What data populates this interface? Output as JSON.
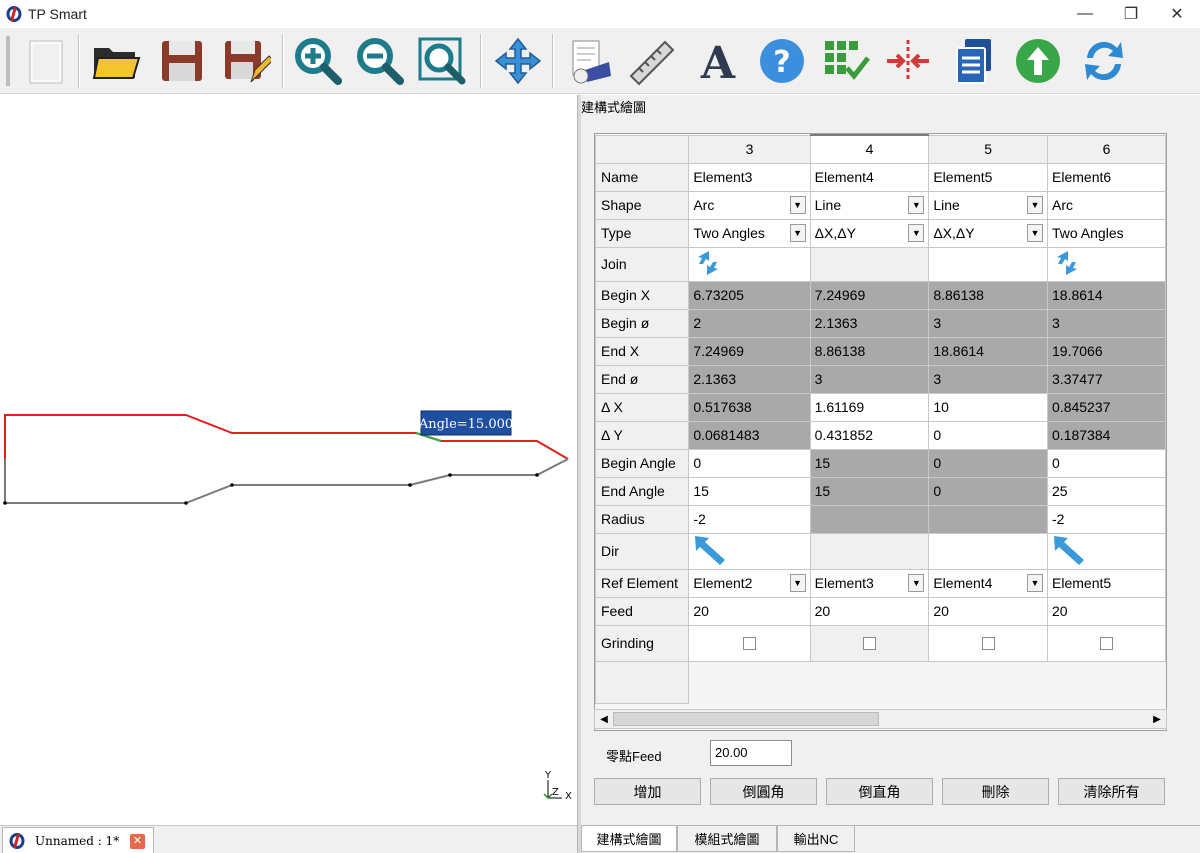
{
  "window": {
    "title": "TP Smart",
    "minimize": "—",
    "restore": "❐",
    "close": "✕"
  },
  "toolbar": {
    "buttons": [
      "new-icon",
      "open-folder-icon",
      "save-icon",
      "save-as-icon",
      "zoom-in-icon",
      "zoom-out-icon",
      "zoom-fit-icon",
      "pan-icon",
      "print-preview-icon",
      "ruler-icon",
      "text-icon",
      "help-icon",
      "grid-check-icon",
      "split-icon",
      "copy-icon",
      "upload-icon",
      "refresh-icon"
    ]
  },
  "canvas": {
    "tooltip": "Angle=15.000",
    "axis_y": "Y",
    "axis_z": "Z",
    "axis_x": "X"
  },
  "doc_tab": {
    "label": "Unnamed : 1*",
    "close": "✕"
  },
  "panel": {
    "title": "建構式繪圖"
  },
  "grid": {
    "columns": [
      "3",
      "4",
      "5",
      "6"
    ],
    "active_column": "4",
    "row_labels": {
      "name": "Name",
      "shape": "Shape",
      "type": "Type",
      "join": "Join",
      "begin_x": "Begin X",
      "begin_d": "Begin ø",
      "end_x": "End X",
      "end_d": "End ø",
      "dx": "Δ X",
      "dy": "Δ Y",
      "begin_angle": "Begin Angle",
      "end_angle": "End Angle",
      "radius": "Radius",
      "dir": "Dir",
      "ref": "Ref Element",
      "feed": "Feed",
      "grinding": "Grinding"
    },
    "cells": {
      "name": [
        "Element3",
        "Element4",
        "Element5",
        "Element6"
      ],
      "shape": [
        "Arc",
        "Line",
        "Line",
        "Arc"
      ],
      "type": [
        "Two Angles",
        "ΔX,ΔY",
        "ΔX,ΔY",
        "Two Angles"
      ],
      "begin_x": [
        "6.73205",
        "7.24969",
        "8.86138",
        "18.8614"
      ],
      "begin_d": [
        "2",
        "2.1363",
        "3",
        "3"
      ],
      "end_x": [
        "7.24969",
        "8.86138",
        "18.8614",
        "19.7066"
      ],
      "end_d": [
        "2.1363",
        "3",
        "3",
        "3.37477"
      ],
      "dx": [
        "0.517638",
        "1.61169",
        "10",
        "0.845237"
      ],
      "dy": [
        "0.0681483",
        "0.431852",
        "0",
        "0.187384"
      ],
      "begin_angle": [
        "0",
        "15",
        "0",
        "0"
      ],
      "end_angle": [
        "15",
        "15",
        "0",
        "25"
      ],
      "radius": [
        "-2",
        "",
        "",
        "-2"
      ],
      "ref": [
        "Element2",
        "Element3",
        "Element4",
        "Element5"
      ],
      "feed": [
        "20",
        "20",
        "20",
        "20"
      ]
    }
  },
  "feed": {
    "label": "零點Feed",
    "value": "20.00"
  },
  "actions": [
    "增加",
    "倒圓角",
    "倒直角",
    "刪除",
    "清除所有"
  ],
  "tabs": [
    "建構式繪圖",
    "模組式繪圖",
    "輸出NC"
  ],
  "colors": {
    "profile_red": "#e0201c",
    "profile_gray": "#7a7a7a",
    "tooltip_bg": "#1f4f9e",
    "accent_blue": "#3a9ad9"
  }
}
